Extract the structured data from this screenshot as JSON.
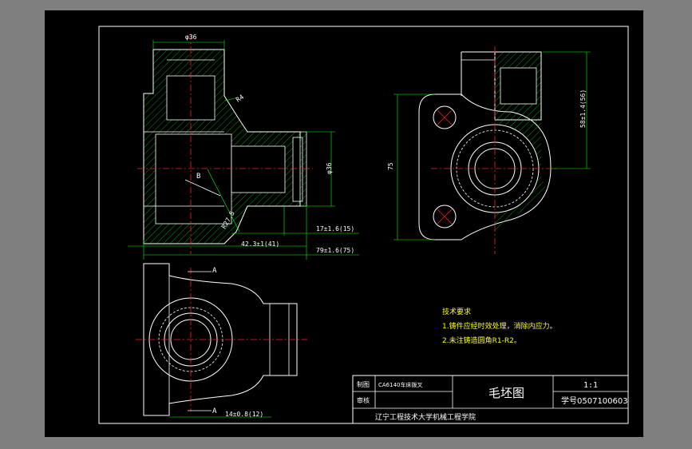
{
  "drawing": {
    "background_color": "#000000",
    "frame_color": "#ffffff",
    "outline_color": "#ffffff",
    "hatch_color": "#00c000",
    "centerline_color": "#ff2020",
    "dimension_color": "#00ff00",
    "notes_color": "#ffff00"
  },
  "dimensions": {
    "phi36_top": "φ36",
    "bore_right": "φ36",
    "r4": "R4",
    "dim_17": "17±1.6(15)",
    "dim_42": "42.3±1(41)",
    "dim_79": "79±1.6(75)",
    "dim_r27": "R27.5",
    "dim_75": "75",
    "dim_58": "58±1.4(56)",
    "dim_14": "14±0.8(12)",
    "label_b": "B",
    "label_a_top": "A",
    "label_a_bottom": "A"
  },
  "notes": {
    "title": "技术要求",
    "line1": "1.铸件应经时效处理，消除内应力。",
    "line2": "2.未注铸造圆角R1-R2。"
  },
  "title_block": {
    "drawn_label": "制图",
    "drawn_value": "CA6140车床拨叉",
    "check_label": "审核",
    "drawing_name": "毛坯图",
    "scale": "1:1",
    "student_no": "学号0507100603",
    "school": "辽宁工程技术大学机械工程学院"
  }
}
